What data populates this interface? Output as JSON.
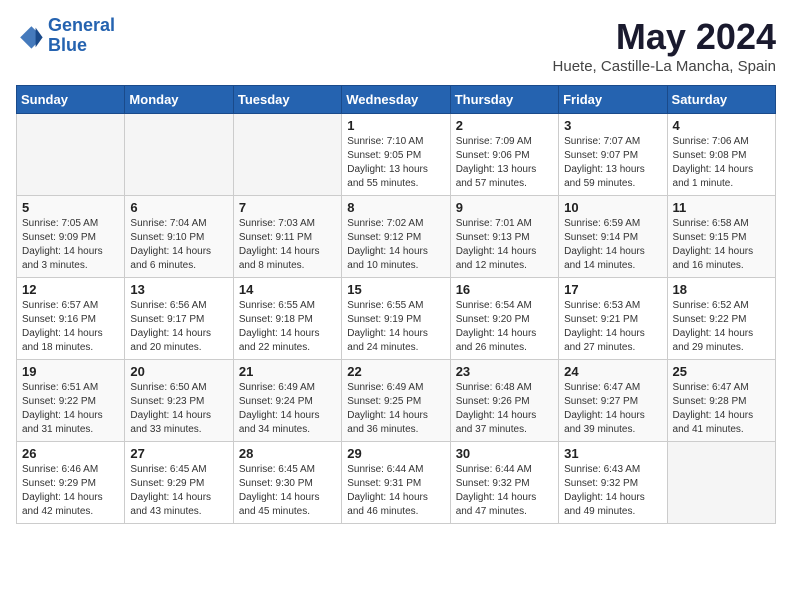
{
  "header": {
    "logo_line1": "General",
    "logo_line2": "Blue",
    "main_title": "May 2024",
    "subtitle": "Huete, Castille-La Mancha, Spain"
  },
  "days_of_week": [
    "Sunday",
    "Monday",
    "Tuesday",
    "Wednesday",
    "Thursday",
    "Friday",
    "Saturday"
  ],
  "weeks": [
    [
      {
        "day": "",
        "sunrise": "",
        "sunset": "",
        "daylight": ""
      },
      {
        "day": "",
        "sunrise": "",
        "sunset": "",
        "daylight": ""
      },
      {
        "day": "",
        "sunrise": "",
        "sunset": "",
        "daylight": ""
      },
      {
        "day": "1",
        "sunrise": "7:10 AM",
        "sunset": "9:05 PM",
        "daylight": "13 hours and 55 minutes."
      },
      {
        "day": "2",
        "sunrise": "7:09 AM",
        "sunset": "9:06 PM",
        "daylight": "13 hours and 57 minutes."
      },
      {
        "day": "3",
        "sunrise": "7:07 AM",
        "sunset": "9:07 PM",
        "daylight": "13 hours and 59 minutes."
      },
      {
        "day": "4",
        "sunrise": "7:06 AM",
        "sunset": "9:08 PM",
        "daylight": "14 hours and 1 minute."
      }
    ],
    [
      {
        "day": "5",
        "sunrise": "7:05 AM",
        "sunset": "9:09 PM",
        "daylight": "14 hours and 3 minutes."
      },
      {
        "day": "6",
        "sunrise": "7:04 AM",
        "sunset": "9:10 PM",
        "daylight": "14 hours and 6 minutes."
      },
      {
        "day": "7",
        "sunrise": "7:03 AM",
        "sunset": "9:11 PM",
        "daylight": "14 hours and 8 minutes."
      },
      {
        "day": "8",
        "sunrise": "7:02 AM",
        "sunset": "9:12 PM",
        "daylight": "14 hours and 10 minutes."
      },
      {
        "day": "9",
        "sunrise": "7:01 AM",
        "sunset": "9:13 PM",
        "daylight": "14 hours and 12 minutes."
      },
      {
        "day": "10",
        "sunrise": "6:59 AM",
        "sunset": "9:14 PM",
        "daylight": "14 hours and 14 minutes."
      },
      {
        "day": "11",
        "sunrise": "6:58 AM",
        "sunset": "9:15 PM",
        "daylight": "14 hours and 16 minutes."
      }
    ],
    [
      {
        "day": "12",
        "sunrise": "6:57 AM",
        "sunset": "9:16 PM",
        "daylight": "14 hours and 18 minutes."
      },
      {
        "day": "13",
        "sunrise": "6:56 AM",
        "sunset": "9:17 PM",
        "daylight": "14 hours and 20 minutes."
      },
      {
        "day": "14",
        "sunrise": "6:55 AM",
        "sunset": "9:18 PM",
        "daylight": "14 hours and 22 minutes."
      },
      {
        "day": "15",
        "sunrise": "6:55 AM",
        "sunset": "9:19 PM",
        "daylight": "14 hours and 24 minutes."
      },
      {
        "day": "16",
        "sunrise": "6:54 AM",
        "sunset": "9:20 PM",
        "daylight": "14 hours and 26 minutes."
      },
      {
        "day": "17",
        "sunrise": "6:53 AM",
        "sunset": "9:21 PM",
        "daylight": "14 hours and 27 minutes."
      },
      {
        "day": "18",
        "sunrise": "6:52 AM",
        "sunset": "9:22 PM",
        "daylight": "14 hours and 29 minutes."
      }
    ],
    [
      {
        "day": "19",
        "sunrise": "6:51 AM",
        "sunset": "9:22 PM",
        "daylight": "14 hours and 31 minutes."
      },
      {
        "day": "20",
        "sunrise": "6:50 AM",
        "sunset": "9:23 PM",
        "daylight": "14 hours and 33 minutes."
      },
      {
        "day": "21",
        "sunrise": "6:49 AM",
        "sunset": "9:24 PM",
        "daylight": "14 hours and 34 minutes."
      },
      {
        "day": "22",
        "sunrise": "6:49 AM",
        "sunset": "9:25 PM",
        "daylight": "14 hours and 36 minutes."
      },
      {
        "day": "23",
        "sunrise": "6:48 AM",
        "sunset": "9:26 PM",
        "daylight": "14 hours and 37 minutes."
      },
      {
        "day": "24",
        "sunrise": "6:47 AM",
        "sunset": "9:27 PM",
        "daylight": "14 hours and 39 minutes."
      },
      {
        "day": "25",
        "sunrise": "6:47 AM",
        "sunset": "9:28 PM",
        "daylight": "14 hours and 41 minutes."
      }
    ],
    [
      {
        "day": "26",
        "sunrise": "6:46 AM",
        "sunset": "9:29 PM",
        "daylight": "14 hours and 42 minutes."
      },
      {
        "day": "27",
        "sunrise": "6:45 AM",
        "sunset": "9:29 PM",
        "daylight": "14 hours and 43 minutes."
      },
      {
        "day": "28",
        "sunrise": "6:45 AM",
        "sunset": "9:30 PM",
        "daylight": "14 hours and 45 minutes."
      },
      {
        "day": "29",
        "sunrise": "6:44 AM",
        "sunset": "9:31 PM",
        "daylight": "14 hours and 46 minutes."
      },
      {
        "day": "30",
        "sunrise": "6:44 AM",
        "sunset": "9:32 PM",
        "daylight": "14 hours and 47 minutes."
      },
      {
        "day": "31",
        "sunrise": "6:43 AM",
        "sunset": "9:32 PM",
        "daylight": "14 hours and 49 minutes."
      },
      {
        "day": "",
        "sunrise": "",
        "sunset": "",
        "daylight": ""
      }
    ]
  ]
}
